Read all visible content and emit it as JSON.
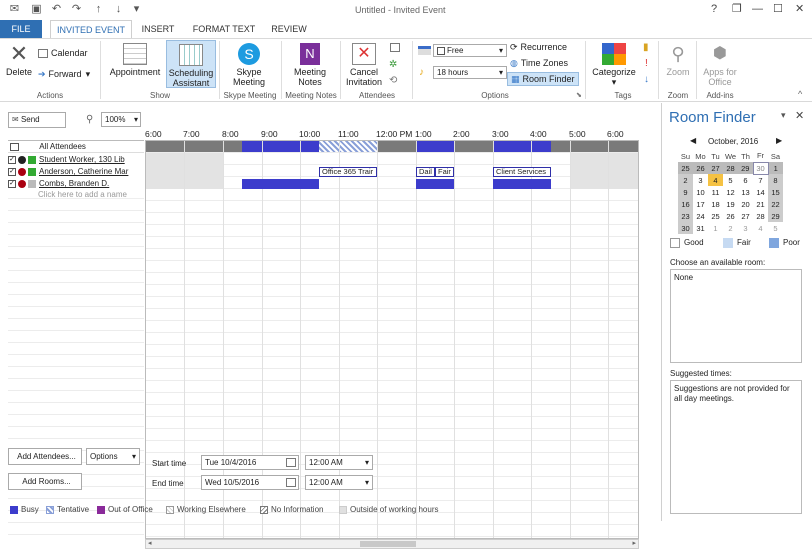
{
  "window": {
    "title": "Untitled - Invited Event",
    "help": "?",
    "restore": "❐",
    "minimize": "—",
    "maximize": "☐",
    "close": "✕"
  },
  "tabs": [
    "FILE",
    "INVITED EVENT",
    "INSERT",
    "FORMAT TEXT",
    "REVIEW"
  ],
  "ribbon": {
    "actions": {
      "label": "Actions",
      "delete": "Delete",
      "calendar": "Calendar",
      "forward": "Forward"
    },
    "show": {
      "label": "Show",
      "appointment": "Appointment",
      "scheduling_l1": "Scheduling",
      "scheduling_l2": "Assistant"
    },
    "skype": {
      "label": "Skype Meeting",
      "btn_l1": "Skype",
      "btn_l2": "Meeting"
    },
    "notes": {
      "label": "Meeting Notes",
      "btn_l1": "Meeting",
      "btn_l2": "Notes"
    },
    "attendees": {
      "label": "Attendees",
      "cancel_l1": "Cancel",
      "cancel_l2": "Invitation"
    },
    "options": {
      "label": "Options",
      "show_as": "Free",
      "reminder": "18 hours",
      "recurrence": "Recurrence",
      "time_zones": "Time Zones",
      "room_finder": "Room Finder"
    },
    "tags": {
      "label": "Tags",
      "categorize": "Categorize"
    },
    "zoom": {
      "label": "Zoom",
      "btn": "Zoom"
    },
    "addins": {
      "label": "Add-ins",
      "btn_l1": "Apps for",
      "btn_l2": "Office"
    }
  },
  "scheduler": {
    "send": "Send",
    "zoom": "100%",
    "hours": [
      "6:00",
      "7:00",
      "8:00",
      "9:00",
      "10:00",
      "11:00",
      "12:00 PM",
      "1:00",
      "2:00",
      "3:00",
      "4:00",
      "5:00",
      "6:00"
    ],
    "all_attendees": "All Attendees",
    "attendees": [
      {
        "name": "Student Worker, 130 Lib",
        "color": "#33aa33"
      },
      {
        "name": "Anderson, Catherine Mar",
        "color": "#33aa33"
      },
      {
        "name": "Combs, Branden D.",
        "color": "#bbbbbb"
      }
    ],
    "add_placeholder": "Click here to add a name",
    "events": [
      "Office 365 Trair",
      "Dail",
      "Fair",
      "Client Services"
    ],
    "add_attendees": "Add Attendees...",
    "options": "Options",
    "add_rooms": "Add Rooms...",
    "start_label": "Start time",
    "start_date": "Tue 10/4/2016",
    "start_time": "12:00 AM",
    "end_label": "End time",
    "end_date": "Wed 10/5/2016",
    "end_time": "12:00 AM"
  },
  "legend": [
    "Busy",
    "Tentative",
    "Out of Office",
    "Working Elsewhere",
    "No Information",
    "Outside of working hours"
  ],
  "legend_colors": [
    "#3c3ccc",
    "#8aa0d8",
    "#8a2a9a",
    "#ffffff",
    "#ffffff",
    "#e0e0e0"
  ],
  "room_finder": {
    "title": "Room Finder",
    "month": "October, 2016",
    "days": [
      "Su",
      "Mo",
      "Tu",
      "We",
      "Th",
      "Fr",
      "Sa"
    ],
    "weeks": [
      [
        "25",
        "26",
        "27",
        "28",
        "29",
        "30",
        "1"
      ],
      [
        "2",
        "3",
        "4",
        "5",
        "6",
        "7",
        "8"
      ],
      [
        "9",
        "10",
        "11",
        "12",
        "13",
        "14",
        "15"
      ],
      [
        "16",
        "17",
        "18",
        "19",
        "20",
        "21",
        "22"
      ],
      [
        "23",
        "24",
        "25",
        "26",
        "27",
        "28",
        "29"
      ],
      [
        "30",
        "31",
        "1",
        "2",
        "3",
        "4",
        "5"
      ]
    ],
    "good": "Good",
    "fair": "Fair",
    "poor": "Poor",
    "choose_room": "Choose an available room:",
    "room_value": "None",
    "suggested": "Suggested times:",
    "suggest_text": "Suggestions are not provided for all day meetings."
  }
}
